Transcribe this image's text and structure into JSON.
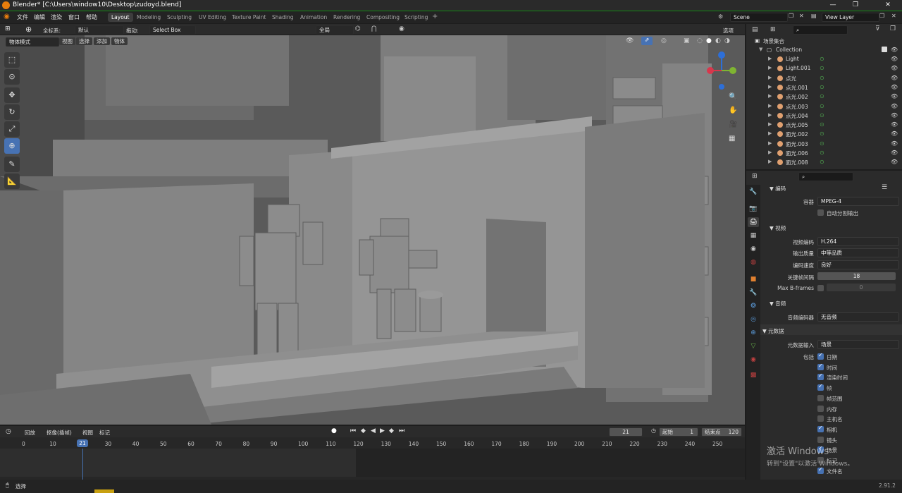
{
  "window": {
    "title": "Blender* [C:\\Users\\window10\\Desktop\\zudoyd.blend]"
  },
  "menu": [
    "文件",
    "编辑",
    "渲染",
    "窗口",
    "帮助"
  ],
  "workspaces": [
    "Layout",
    "Modeling",
    "Sculpting",
    "UV Editing",
    "Texture Paint",
    "Shading",
    "Animation",
    "Rendering",
    "Compositing",
    "Scripting"
  ],
  "active_workspace": "Layout",
  "scene_name": "Scene",
  "view_layer": "View Layer",
  "viewport_header": {
    "orient_label": "全标系:",
    "orient_value": "默认",
    "drag_label": "拖动:",
    "drag_value": "Select Box",
    "pivot_value": "全局",
    "options_label": "选项"
  },
  "viewport_header2": {
    "mode": "物体模式",
    "items": [
      "视图",
      "选择",
      "添加",
      "物体"
    ]
  },
  "timeline_header": {
    "items": [
      "回放",
      "抠像(插帧)",
      "视图",
      "标记"
    ],
    "current_frame": "21",
    "start_label": "起始",
    "start_value": "1",
    "end_label": "结束点",
    "end_value": "120"
  },
  "timeline_ticks": [
    "0",
    "10",
    "21",
    "30",
    "40",
    "50",
    "60",
    "70",
    "80",
    "90",
    "100",
    "110",
    "120",
    "130",
    "140",
    "150",
    "160",
    "170",
    "180",
    "190",
    "200",
    "210",
    "220",
    "230",
    "240",
    "250"
  ],
  "status": {
    "left": "选择",
    "version": "2.91.2"
  },
  "outliner": {
    "root": "场景集合",
    "collection": "Collection",
    "items": [
      "Light",
      "Light.001",
      "点光",
      "点光.001",
      "点光.002",
      "点光.003",
      "点光.004",
      "点光.005",
      "面光.002",
      "面光.003",
      "面光.006",
      "面光.008"
    ]
  },
  "properties": {
    "encoding_section": "编码",
    "container_label": "容器",
    "container_value": "MPEG-4",
    "autosplit_label": "自动分割输出",
    "video_section": "视频",
    "codec_label": "视频编码",
    "codec_value": "H.264",
    "quality_label": "输出质量",
    "quality_value": "中等品质",
    "speed_label": "编码速度",
    "speed_value": "良好",
    "keyframe_label": "关键帧间隔",
    "keyframe_value": "18",
    "bframes_label": "Max B-frames",
    "bframes_value": "0",
    "audio_section": "音频",
    "audio_codec_label": "音频编码器",
    "audio_codec_value": "无音频",
    "metadata_section": "元数据",
    "metadata_input_label": "元数据输入",
    "metadata_input_value": "场景",
    "include_label": "包括",
    "include_items": [
      {
        "label": "日期",
        "on": true
      },
      {
        "label": "时间",
        "on": true
      },
      {
        "label": "渲染时间",
        "on": true
      },
      {
        "label": "帧",
        "on": true
      },
      {
        "label": "帧范围",
        "on": false
      },
      {
        "label": "内存",
        "on": false
      },
      {
        "label": "主机名",
        "on": false
      },
      {
        "label": "相机",
        "on": true
      },
      {
        "label": "镜头",
        "on": false
      },
      {
        "label": "场景",
        "on": true
      },
      {
        "label": "标记",
        "on": false
      },
      {
        "label": "文件名",
        "on": true
      }
    ]
  },
  "watermark": {
    "line1": "激活 Windows",
    "line2": "转到\"设置\"以激活 Windows。"
  }
}
